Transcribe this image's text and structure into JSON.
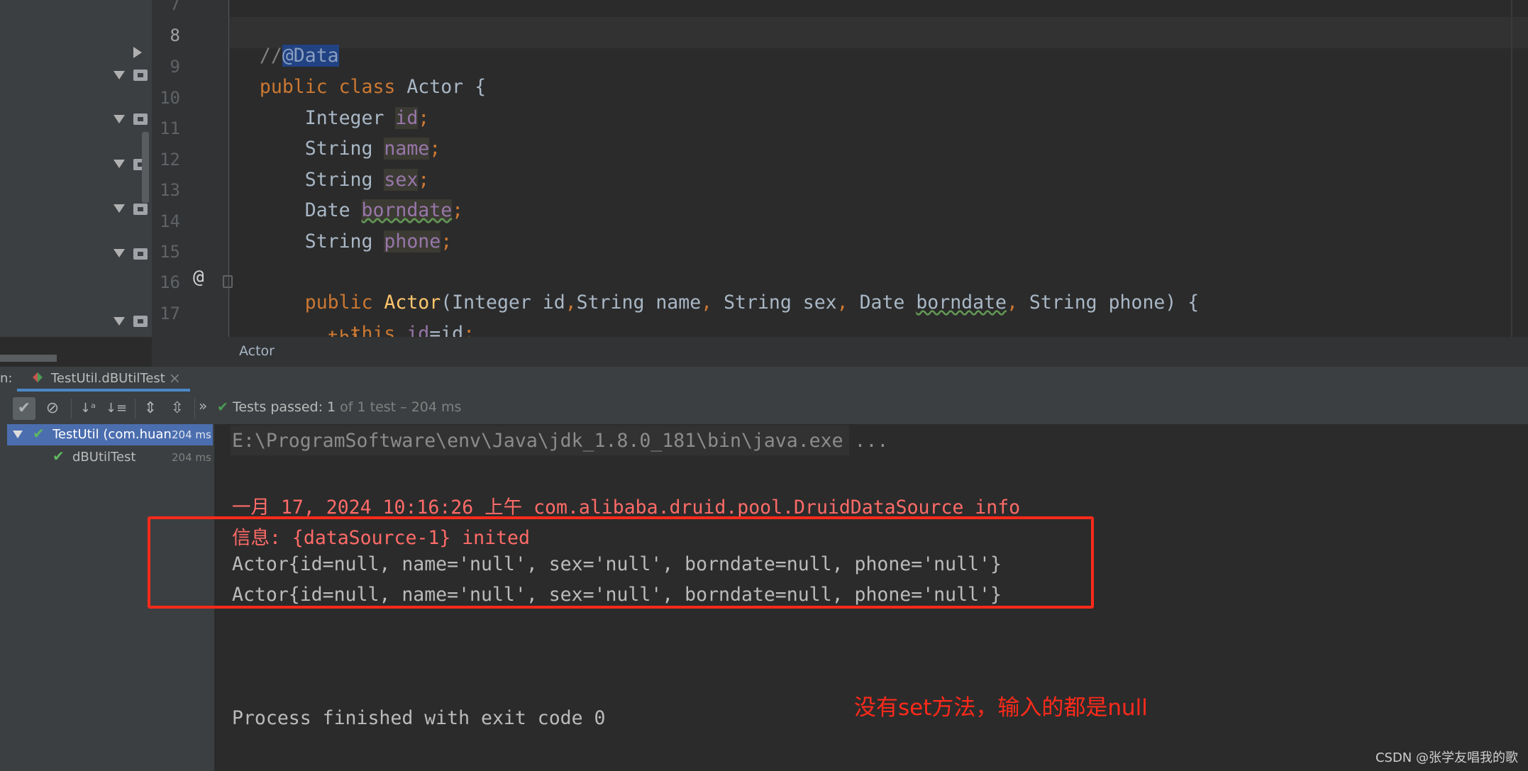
{
  "editor": {
    "line_numbers": [
      "7",
      "8",
      "9",
      "10",
      "11",
      "12",
      "13",
      "14",
      "15",
      "16",
      "17"
    ],
    "lines": {
      "l8_prefix": "//",
      "l8_annotation": "@Data",
      "l9_kw": "public class ",
      "l9_rest": "Actor {",
      "l10_type": "    Integer ",
      "l10_field": "id",
      "l10_semi": ";",
      "l11_type": "    String ",
      "l11_field": "name",
      "l11_semi": ";",
      "l12_type": "    String ",
      "l12_field": "sex",
      "l12_semi": ";",
      "l13_type": "    Date ",
      "l13_field": "borndate",
      "l13_semi": ";",
      "l14_type": "    String ",
      "l14_field": "phone",
      "l14_semi": ";",
      "l16_kw": "    public ",
      "l16_method": "Actor",
      "l16_p1": "(Integer id",
      "l16_c1": ",",
      "l16_p2": "String name",
      "l16_c2": ", ",
      "l16_p3": "String sex",
      "l16_c3": ", ",
      "l16_p4a": "Date ",
      "l16_p4b": "borndate",
      "l16_c4": ", ",
      "l16_p5": "String phone) {",
      "l17_kw": "        this",
      "l17_dot": ".",
      "l17_field": "id",
      "l17_rest": "=id",
      "l17_semi": ";",
      "l18_partial": "        thi"
    },
    "override_marker": "@",
    "breadcrumb": "Actor"
  },
  "run_panel": {
    "label": "n:",
    "tab_title": "TestUtil.dBUtilTest",
    "tab_close": "×",
    "more": "»",
    "status_passed": "Tests passed: ",
    "status_count": "1",
    "status_detail": " of 1 test – 204 ms",
    "tree": [
      {
        "label": "TestUtil (com.huan",
        "time": "204 ms"
      },
      {
        "label": "dBUtilTest",
        "time": "204 ms"
      }
    ]
  },
  "console": {
    "java_cmd": "E:\\ProgramSoftware\\env\\Java\\jdk_1.8.0_181\\bin\\java.exe ...",
    "log_line1": "一月 17, 2024 10:16:26 上午 com.alibaba.druid.pool.DruidDataSource info",
    "log_line2": "信息: {dataSource-1} inited",
    "out_line1": "Actor{id=null, name='null', sex='null', borndate=null, phone='null'}",
    "out_line2": "Actor{id=null, name='null', sex='null', borndate=null, phone='null'}",
    "exit_line": "Process finished with exit code 0"
  },
  "annotation_text": "没有set方法，输入的都是null",
  "watermark": "CSDN @张学友唱我的歌",
  "colors": {
    "keyword": "#cc7832",
    "field": "#9876aa",
    "method": "#ffc66d",
    "comment": "#808080",
    "error_text": "#ff6b68",
    "annotation_red": "#ff2a1a",
    "pass_green": "#499c54"
  }
}
